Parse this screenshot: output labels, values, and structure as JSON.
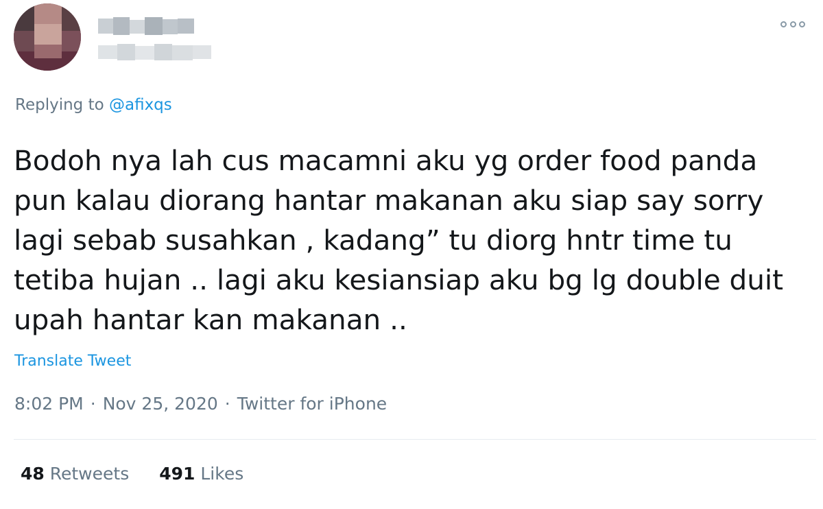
{
  "tweet": {
    "author": {
      "avatar_icon": "blurred-avatar",
      "name_blurred": true,
      "handle_blurred": true
    },
    "more_icon": "more-options-icon",
    "replying_prefix": "Replying to ",
    "replying_mention": "@afixqs",
    "text": "Bodoh nya lah cus macamni aku yg order food panda\npun kalau diorang hantar makanan aku siap say sorry\nlagi sebab susahkan , kadang” tu diorg hntr time tu\ntetiba hujan .. lagi aku kesiansiap aku bg lg double duit\nupah hantar kan makanan ..",
    "translate_label": "Translate Tweet",
    "time": "8:02 PM",
    "separator": "·",
    "date": "Nov 25, 2020",
    "source": "Twitter for iPhone",
    "retweets_count": "48",
    "retweets_label": "Retweets",
    "likes_count": "491",
    "likes_label": "Likes"
  },
  "colors": {
    "text": "#14171a",
    "secondary": "#657786",
    "link": "#1b95e0",
    "divider": "#e6ecf0"
  }
}
